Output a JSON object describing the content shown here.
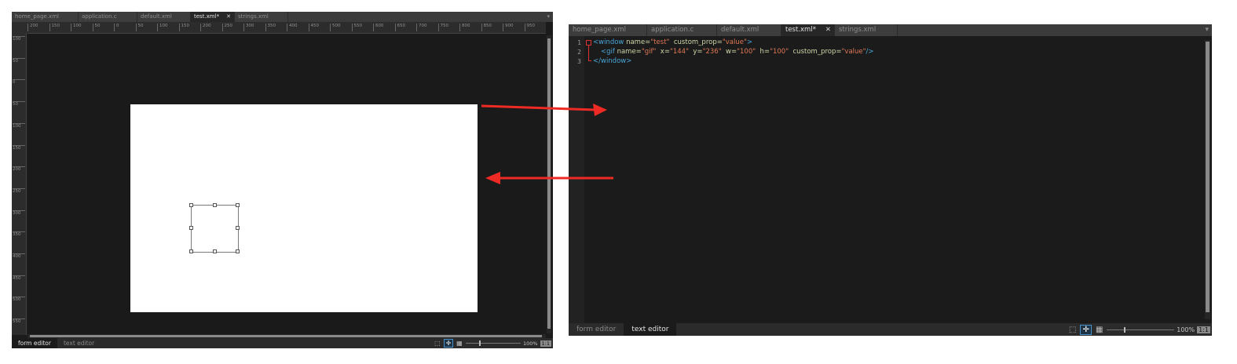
{
  "form_editor": {
    "tabs": [
      {
        "label": "home_page.xml",
        "active": false
      },
      {
        "label": "application.c",
        "active": false
      },
      {
        "label": "default.xml",
        "active": false
      },
      {
        "label": "test.xml*",
        "active": true
      },
      {
        "label": "strings.xml",
        "active": false
      }
    ],
    "close_glyph": "✕",
    "menu_glyph": "▾",
    "ruler_top": [
      "200",
      "150",
      "100",
      "50",
      "0",
      "50",
      "100",
      "150",
      "200",
      "250",
      "300",
      "350",
      "400",
      "450",
      "500",
      "550",
      "600",
      "650",
      "700",
      "750",
      "800",
      "850",
      "900",
      "950"
    ],
    "ruler_left": [
      "100",
      "50",
      "0",
      "50",
      "100",
      "150",
      "200",
      "250",
      "300",
      "350",
      "400",
      "450",
      "500",
      "550"
    ],
    "bottom_tabs": [
      {
        "label": "form  editor",
        "active": true
      },
      {
        "label": "text  editor",
        "active": false
      }
    ],
    "zoom": {
      "level": 0.25,
      "text": "100%"
    },
    "one_to_one": "1:1"
  },
  "text_editor": {
    "tabs": [
      {
        "label": "home_page.xml",
        "active": false
      },
      {
        "label": "application.c",
        "active": false
      },
      {
        "label": "default.xml",
        "active": false
      },
      {
        "label": "test.xml*",
        "active": true
      },
      {
        "label": "strings.xml",
        "active": false
      }
    ],
    "close_glyph": "✕",
    "menu_glyph": "▾",
    "line_numbers": [
      "1",
      "2",
      "3"
    ],
    "code": {
      "l1_open": "<window",
      "l1_name_attr": " name=",
      "l1_name_val": "\"test\"",
      "l1_prop_attr": "  custom_prop=",
      "l1_prop_val": "\"value\"",
      "l1_close": ">",
      "l2_open": "<gif",
      "l2_name_attr": " name=",
      "l2_name_val": "\"gif\"",
      "l2_x_attr": "  x=",
      "l2_x_val": "\"144\"",
      "l2_y_attr": "  y=",
      "l2_y_val": "\"236\"",
      "l2_w_attr": "  w=",
      "l2_w_val": "\"100\"",
      "l2_h_attr": "  h=",
      "l2_h_val": "\"100\"",
      "l2_prop_attr": "  custom_prop=",
      "l2_prop_val": "\"value\"",
      "l2_close": "/>",
      "l3": "</window>"
    },
    "bottom_tabs": [
      {
        "label": "form  editor",
        "active": false
      },
      {
        "label": "text  editor",
        "active": true
      }
    ],
    "zoom": {
      "level": 0.25,
      "text": "100%"
    },
    "one_to_one": "1:1"
  },
  "icons": {
    "select_tool": "⬚",
    "move_tool": "✛",
    "grid_tool": "▦"
  },
  "colors": {
    "arrow": "#ee2a24",
    "tag": "#4aa6d8",
    "value": "#e07856"
  }
}
